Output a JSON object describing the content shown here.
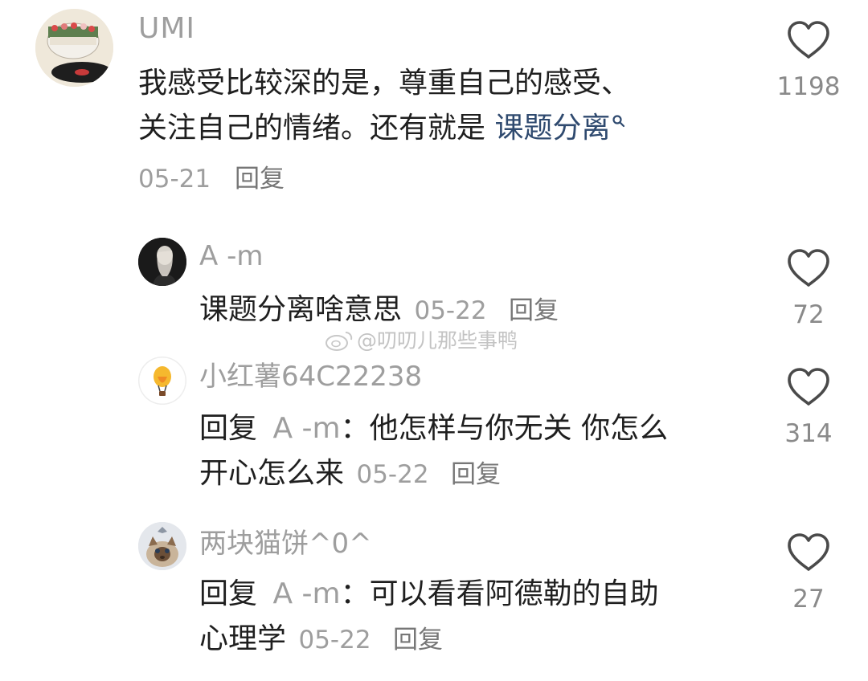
{
  "main_comment": {
    "username": "UMI",
    "text_line1": "我感受比较深的是，尊重自己的感受、",
    "text_line2_prefix": "关注自己的情绪。还有就是 ",
    "topic_link": "课题分离",
    "date": "05-21",
    "reply_label": "回复",
    "like_count": "1198"
  },
  "replies": [
    {
      "username": "A -m",
      "text": "课题分离啥意思",
      "date": "05-22",
      "reply_label": "回复",
      "like_count": "72"
    },
    {
      "username": "小红薯64C22238",
      "reply_prefix": "回复",
      "mention": "A -m",
      "colon": "：",
      "text_line1": "他怎样与你无关 你怎么",
      "text_line2": "开心怎么来",
      "date": "05-22",
      "reply_label": "回复",
      "like_count": "314"
    },
    {
      "username": "两块猫饼^0^",
      "reply_prefix": "回复",
      "mention": "A -m",
      "colon": "：",
      "text_line1": "可以看看阿德勒的自助",
      "text_line2": "心理学",
      "date": "05-22",
      "reply_label": "回复",
      "like_count": "27"
    }
  ],
  "watermark": "@叨叨儿那些事鸭",
  "colors": {
    "text": "#1f1f1f",
    "meta": "#9e9e9e",
    "link": "#2f4a6f",
    "icon": "#4a4a4a"
  }
}
